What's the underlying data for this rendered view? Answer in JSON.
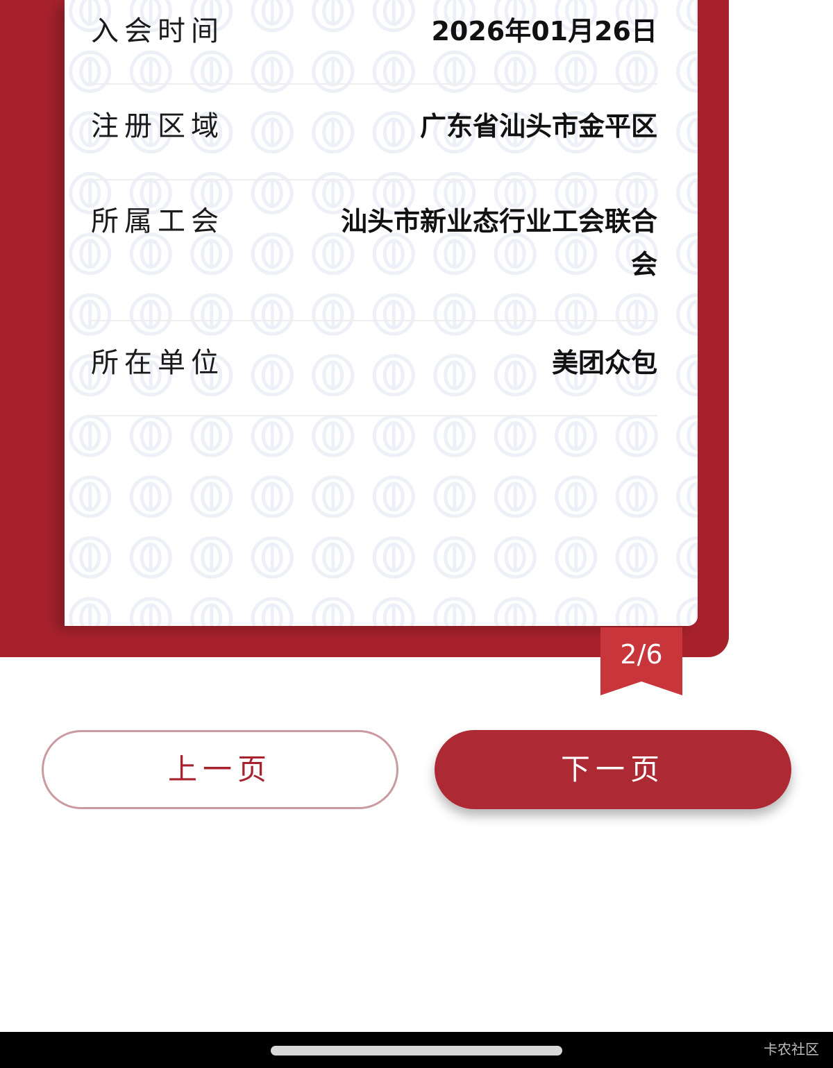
{
  "info": {
    "rows": [
      {
        "label": "入会时间",
        "value": "2026年01月26日"
      },
      {
        "label": "注册区域",
        "value": "广东省汕头市金平区"
      },
      {
        "label": "所属工会",
        "value": "汕头市新业态行业工会联合会"
      },
      {
        "label": "所在单位",
        "value": "美团众包"
      }
    ]
  },
  "pagination": {
    "indicator": "2/6"
  },
  "buttons": {
    "prev_label": "上一页",
    "next_label": "下一页"
  },
  "footer": {
    "watermark": "卡农社区"
  },
  "colors": {
    "brand_red": "#a8222d",
    "bookmark_red": "#c8353b",
    "button_red": "#ad2a34",
    "watermark_icon": "#eef0f6"
  },
  "icons": {
    "background_pattern": "union-emblem-icon",
    "bookmark": "ribbon-bookmark-icon"
  }
}
